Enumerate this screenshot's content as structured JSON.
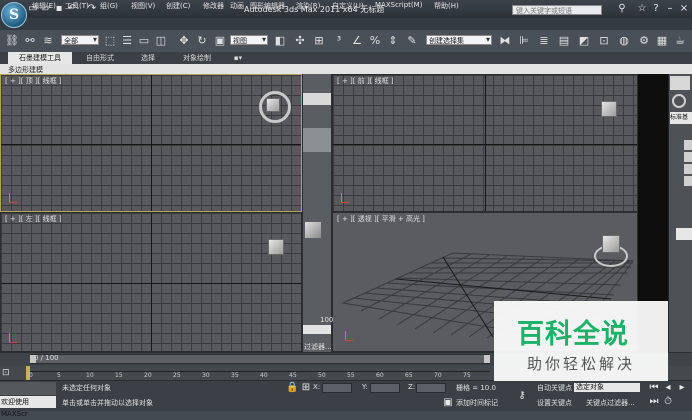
{
  "window": {
    "title": "Autodesk 3ds Max  2011 x64    无标题",
    "search_placeholder": "键入关键字或短语"
  },
  "menu": [
    "编辑(E)",
    "工具(T)",
    "组(G)",
    "视图(V)",
    "创建(C)",
    "修改器",
    "动画",
    "图形编辑器",
    "渲染(R)",
    "自定义(U)",
    "MAXScript(M)",
    "帮助(H)"
  ],
  "toolbar": {
    "selection_filter": "全部",
    "ref_coord": "视图",
    "named_selection": "创建选择集"
  },
  "ribbon": {
    "tabs": [
      "石墨建模工具",
      "自由形式",
      "选择",
      "对象绘制"
    ],
    "active_tab": 0,
    "sub_label": "多边形建模"
  },
  "viewports": {
    "top_left": "[ + ][ 顶 ][ 线框 ]",
    "top_right": "[ + ][ 前 ][ 线框 ]",
    "bottom_left": "[ + ][ 左 ][ 线框 ]",
    "bottom_right": "[ + ][ 透视 ][ 平滑 + 高光 ]"
  },
  "mid_strip": {
    "value": "100",
    "filter_label": "过滤器..."
  },
  "command_panel": {
    "label": "标准基"
  },
  "timeline": {
    "frame_label": "0 / 100",
    "ticks": [
      "0",
      "5",
      "10",
      "15",
      "20",
      "25",
      "30",
      "35",
      "40",
      "45",
      "50",
      "55",
      "60",
      "65",
      "70",
      "75"
    ]
  },
  "status": {
    "welcome": "欢迎使用 MAXScr",
    "selection": "未选定任何对象",
    "prompt": "单击或单击并拖动以选择对象",
    "x_label": "X:",
    "y_label": "Y:",
    "z_label": "Z:",
    "grid": "栅格 = 10.0",
    "add_time_tag": "添加时间标记",
    "auto_key": "自动关键点",
    "selected_object": "选定对象",
    "set_key": "设置关键点",
    "key_filter": "关键点过滤器..."
  },
  "watermark": {
    "title": "百科全说",
    "subtitle": "助你轻松解决"
  },
  "colors": {
    "viewport_bg": "#57595c",
    "active_border": "#b6a45a",
    "watermark_green": "#1cb268"
  }
}
